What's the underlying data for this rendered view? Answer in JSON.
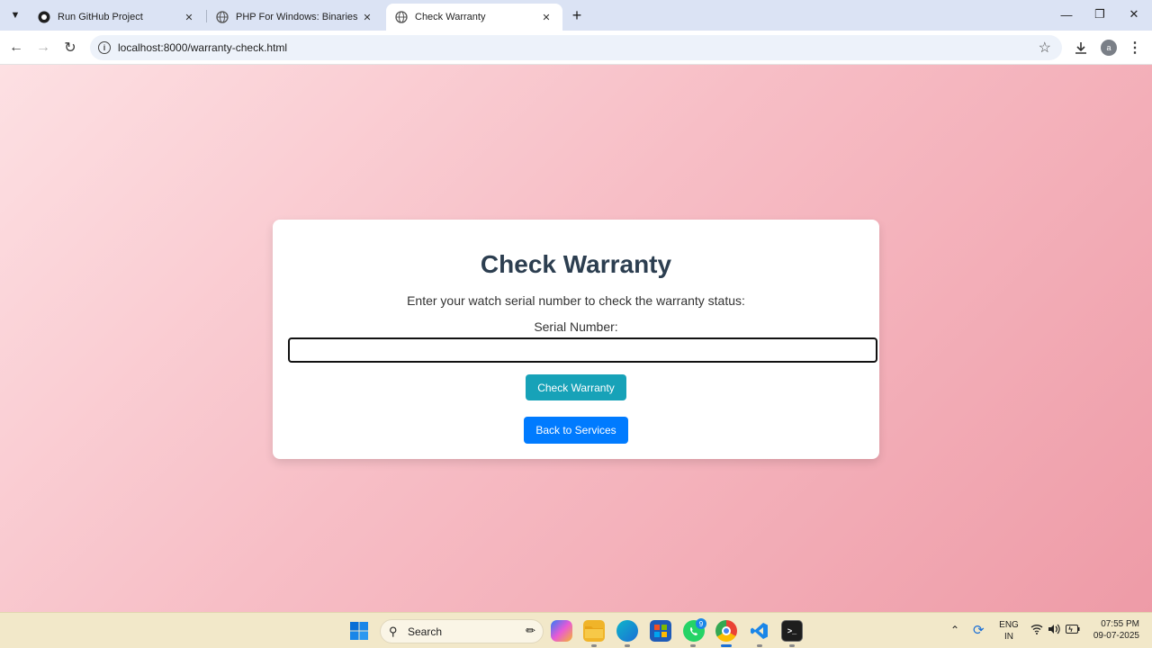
{
  "browser": {
    "tabs": [
      {
        "title": "Run GitHub Project",
        "active": false
      },
      {
        "title": "PHP For Windows: Binaries and",
        "active": false
      },
      {
        "title": "Check Warranty",
        "active": true
      }
    ],
    "url": "localhost:8000/warranty-check.html",
    "profile_initial": "a"
  },
  "page": {
    "heading": "Check Warranty",
    "description": "Enter your watch serial number to check the warranty status:",
    "serial_label": "Serial Number:",
    "serial_value": "",
    "check_button": "Check Warranty",
    "back_button": "Back to Services",
    "colors": {
      "heading": "#2c3e50",
      "check_button": "#17a2b8",
      "back_button": "#007bff"
    }
  },
  "taskbar": {
    "search_label": "Search",
    "whatsapp_badge": "9",
    "language": "ENG",
    "region": "IN",
    "time": "07:55 PM",
    "date": "09-07-2025"
  }
}
